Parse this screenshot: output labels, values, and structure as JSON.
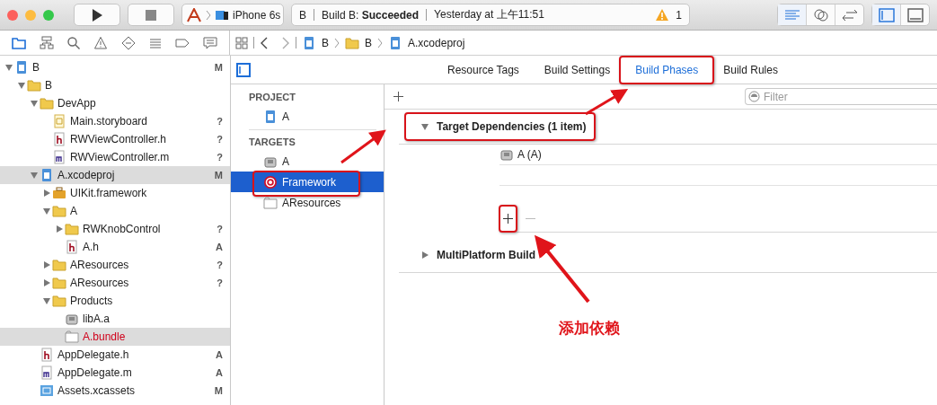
{
  "toolbar": {
    "scheme": "iPhone 6s",
    "activity": {
      "target": "B",
      "status": "Build B: **Succeeded**",
      "time": "Yesterday at 上午11:51",
      "warnings": "1"
    },
    "editor_modes": [
      {
        "kind": "standard",
        "selected": true
      },
      {
        "kind": "assistant",
        "selected": false
      },
      {
        "kind": "version",
        "selected": false
      }
    ],
    "panels": [
      {
        "kind": "navigator",
        "selected": true
      },
      {
        "kind": "debug",
        "selected": false
      }
    ]
  },
  "navigator_tabs": [
    {
      "kind": "folder",
      "selected": true
    },
    {
      "kind": "hierarchy",
      "selected": false
    },
    {
      "kind": "search",
      "selected": false
    },
    {
      "kind": "warning",
      "selected": false
    },
    {
      "kind": "test",
      "selected": false
    },
    {
      "kind": "debug",
      "selected": false
    },
    {
      "kind": "breakpoint",
      "selected": false
    },
    {
      "kind": "report",
      "selected": false
    }
  ],
  "jump_bar": [
    {
      "kind": "project",
      "label": "B"
    },
    {
      "kind": "folder",
      "label": "B"
    },
    {
      "kind": "project",
      "label": "A.xcodeproj"
    }
  ],
  "navigator": [
    {
      "name": "B",
      "kind": "project",
      "badge": "M",
      "expanded": true,
      "selected": false,
      "missing": false,
      "children": [
        {
          "name": "B",
          "kind": "folder",
          "expanded": true,
          "selected": false,
          "missing": false,
          "children": [
            {
              "name": "DevApp",
              "kind": "folder",
              "expanded": true,
              "selected": false,
              "missing": false,
              "children": [
                {
                  "name": "Main.storyboard",
                  "kind": "storyboard",
                  "badge": "?",
                  "selected": false,
                  "missing": false
                },
                {
                  "name": "RWViewController.h",
                  "kind": "header",
                  "badge": "?",
                  "selected": false,
                  "missing": false
                },
                {
                  "name": "RWViewController.m",
                  "kind": "source",
                  "badge": "?",
                  "selected": false,
                  "missing": false
                }
              ]
            },
            {
              "name": "A.xcodeproj",
              "kind": "project",
              "badge": "M",
              "expanded": true,
              "selected": true,
              "missing": false,
              "children": [
                {
                  "name": "UIKit.framework",
                  "kind": "toolbox",
                  "expanded": false,
                  "selected": false,
                  "missing": false
                },
                {
                  "name": "A",
                  "kind": "folder",
                  "expanded": true,
                  "selected": false,
                  "missing": false,
                  "children": [
                    {
                      "name": "RWKnobControl",
                      "kind": "folder",
                      "badge": "?",
                      "expanded": false,
                      "selected": false,
                      "missing": false
                    },
                    {
                      "name": "A.h",
                      "kind": "header",
                      "badge": "A",
                      "selected": false,
                      "missing": false
                    }
                  ]
                },
                {
                  "name": "AResources",
                  "kind": "folder",
                  "badge": "?",
                  "expanded": false,
                  "selected": false,
                  "missing": false
                },
                {
                  "name": "AResources",
                  "kind": "folder",
                  "badge": "?",
                  "expanded": false,
                  "selected": false,
                  "missing": false
                },
                {
                  "name": "Products",
                  "kind": "folder",
                  "expanded": true,
                  "selected": false,
                  "missing": false,
                  "children": [
                    {
                      "name": "libA.a",
                      "kind": "library",
                      "selected": false,
                      "missing": false
                    },
                    {
                      "name": "A.bundle",
                      "kind": "bundle",
                      "selected": true,
                      "missing": true
                    }
                  ]
                }
              ]
            },
            {
              "name": "AppDelegate.h",
              "kind": "header",
              "badge": "A",
              "selected": false,
              "missing": false
            },
            {
              "name": "AppDelegate.m",
              "kind": "source",
              "badge": "A",
              "selected": false,
              "missing": false
            },
            {
              "name": "Assets.xcassets",
              "kind": "assets",
              "badge": "M",
              "selected": false,
              "missing": false
            }
          ]
        }
      ]
    }
  ],
  "editor_tabs": [
    {
      "label": "Resource Tags",
      "selected": false
    },
    {
      "label": "Build Settings",
      "selected": false
    },
    {
      "label": "Build Phases",
      "selected": true
    },
    {
      "label": "Build Rules",
      "selected": false
    }
  ],
  "targets_list": [
    {
      "heading": "PROJECT",
      "items": [
        {
          "name": "A",
          "kind": "project",
          "selected": false
        }
      ]
    },
    {
      "heading": "TARGETS",
      "items": [
        {
          "name": "A",
          "kind": "library",
          "selected": false
        },
        {
          "name": "Framework",
          "kind": "target",
          "selected": true
        },
        {
          "name": "AResources",
          "kind": "bundle",
          "selected": false
        }
      ]
    }
  ],
  "filter": {
    "placeholder": "Filter"
  },
  "phases": [
    {
      "title": "Target Dependencies (1 item)",
      "expanded": true,
      "items": [
        "A (A)"
      ]
    },
    {
      "title": "MultiPlatform Build",
      "expanded": false
    }
  ],
  "annotation": {
    "label": "添加依赖"
  }
}
